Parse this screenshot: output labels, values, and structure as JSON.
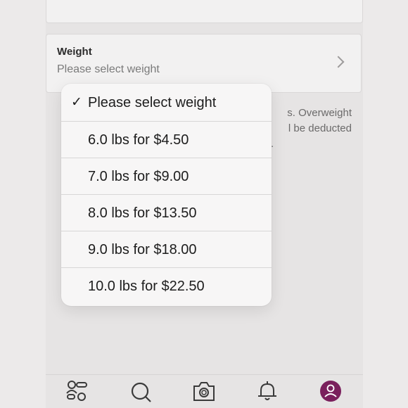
{
  "weight_field": {
    "label": "Weight",
    "value": "Please select weight"
  },
  "info_text": {
    "line1": "s. Overweight",
    "line2": "l be deducted",
    "line3": "."
  },
  "dropdown": {
    "selected_index": 0,
    "options": [
      "Please select weight",
      "6.0 lbs for $4.50",
      "7.0 lbs for $9.00",
      "8.0 lbs for $13.50",
      "9.0 lbs for $18.00",
      "10.0 lbs for $22.50"
    ]
  },
  "tabbar": {
    "items": [
      {
        "icon": "closet-icon"
      },
      {
        "icon": "search-icon"
      },
      {
        "icon": "camera-icon"
      },
      {
        "icon": "bell-icon"
      },
      {
        "icon": "account-icon",
        "active": true
      }
    ],
    "accent": "#7a1f5c"
  }
}
